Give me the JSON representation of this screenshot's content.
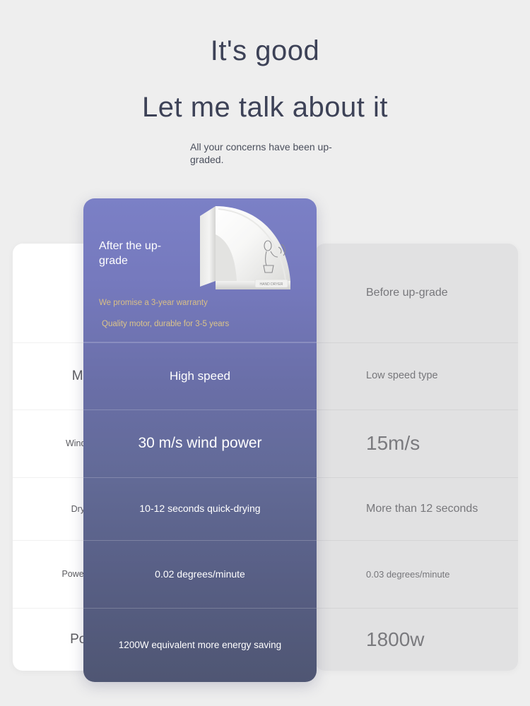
{
  "heading": {
    "line1": "It's good",
    "line2": "Let me talk about it",
    "subtitle": "All your concerns have been up-graded."
  },
  "compare": {
    "after": {
      "title": "After the up-grade",
      "promise_1": "We promise a 3-year warranty",
      "promise_2": "Quality motor, durable for 3-5 years",
      "product_image_alt": "hand-dryer"
    },
    "before": {
      "title": "Before up-grade"
    },
    "rows": [
      {
        "label": "Motor",
        "after": "High speed",
        "before": "Low speed type"
      },
      {
        "label": "Wind speed",
        "after": "30 m/s wind power",
        "before": "15m/s"
      },
      {
        "label": "Dry hand",
        "after": "10-12 seconds quick-drying",
        "before": "More than 12 seconds"
      },
      {
        "label": "Power Saving",
        "after": "0.02 degrees/minute",
        "before": "0.03 degrees/minute"
      },
      {
        "label": "Power",
        "after": "1200W equivalent more energy saving",
        "before": "1800w"
      }
    ]
  },
  "colors": {
    "background": "#eeeeee",
    "heading_text": "#3d4257",
    "card_purple_top": "#7b80c6",
    "card_purple_bottom": "#4f5673",
    "card_gray": "#e1e1e2",
    "gold_text": "#d9bf86"
  }
}
